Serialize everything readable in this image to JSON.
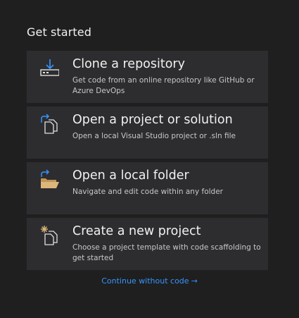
{
  "page": {
    "title": "Get started"
  },
  "cards": [
    {
      "heading": "Clone a repository",
      "description": "Get code from an online repository like GitHub or Azure DevOps",
      "icon": "clone-repository-icon"
    },
    {
      "heading": "Open a project or solution",
      "description": "Open a local Visual Studio project or .sln file",
      "icon": "open-project-icon"
    },
    {
      "heading": "Open a local folder",
      "description": "Navigate and edit code within any folder",
      "icon": "open-folder-icon"
    },
    {
      "heading": "Create a new project",
      "description": "Choose a project template with code scaffolding to get started",
      "icon": "new-project-icon"
    }
  ],
  "footer": {
    "continue_label": "Continue without code",
    "continue_arrow": "→"
  },
  "colors": {
    "background": "#1f1f1f",
    "card": "#2d2d30",
    "accent": "#3794ff",
    "folder": "#dcb67a"
  }
}
